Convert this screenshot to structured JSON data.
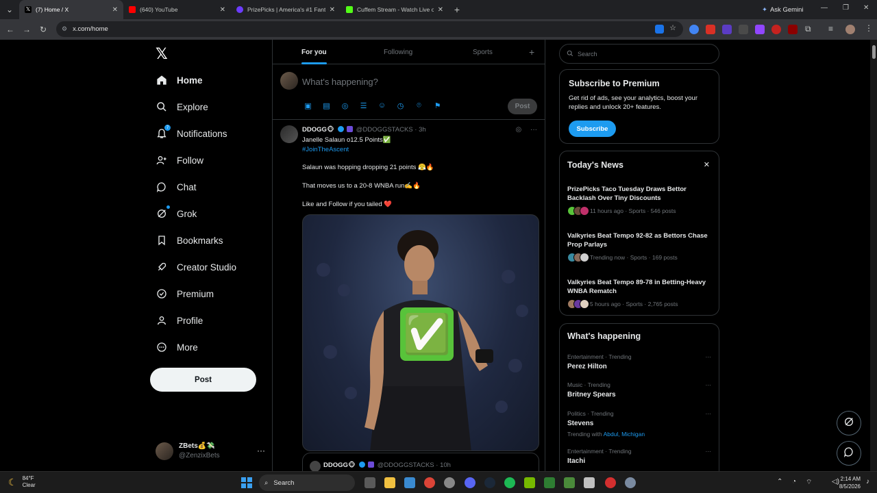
{
  "browser": {
    "tabs": [
      {
        "label": "(7) Home / X",
        "color": "#000000"
      },
      {
        "label": "(640) YouTube",
        "color": "#ff0000"
      },
      {
        "label": "PrizePicks | America's #1 Fanta…",
        "color": "#6c3cff"
      },
      {
        "label": "Cuffem Stream - Watch Live on…",
        "color": "#53fc18"
      }
    ],
    "url": "x.com/home",
    "ask_gemini": "Ask Gemini"
  },
  "nav": {
    "items": [
      {
        "label": "Home",
        "icon": "home-icon"
      },
      {
        "label": "Explore",
        "icon": "search-icon"
      },
      {
        "label": "Notifications",
        "icon": "bell-icon"
      },
      {
        "label": "Follow",
        "icon": "person-add-icon"
      },
      {
        "label": "Chat",
        "icon": "chat-icon"
      },
      {
        "label": "Grok",
        "icon": "grok-icon"
      },
      {
        "label": "Bookmarks",
        "icon": "bookmark-icon"
      },
      {
        "label": "Creator Studio",
        "icon": "rocket-icon"
      },
      {
        "label": "Premium",
        "icon": "verified-icon"
      },
      {
        "label": "Profile",
        "icon": "person-icon"
      },
      {
        "label": "More",
        "icon": "more-circle-icon"
      }
    ],
    "notif_count": "7",
    "post_label": "Post",
    "account": {
      "display_name": "ZBets💰💸",
      "handle": "@ZenzixBets"
    }
  },
  "feed": {
    "tabs": [
      "For you",
      "Following",
      "Sports"
    ],
    "compose_placeholder": "What's happening?",
    "compose_post": "Post",
    "tweet": {
      "display_name": "DDOGG🐵",
      "handle": "@DDOGGSTACKS",
      "time": "3h",
      "lines": [
        "Janelle Salaun o12.5 Points✅",
        "#JoinTheAscent",
        "Salaun was hopping dropping 21 points 😤🔥",
        "That moves us to a 20-8 WNBA run✍️🔥",
        "Like and Follow if you tailed ❤️"
      ],
      "image_badge": "✅",
      "quoted": {
        "display_name": "DDOGG🐵",
        "handle": "@DDOGGSTACKS",
        "time": "10h"
      }
    }
  },
  "right": {
    "search_placeholder": "Search",
    "premium": {
      "title": "Subscribe to Premium",
      "body": "Get rid of ads, see your analytics, boost your replies and unlock 20+ features.",
      "button": "Subscribe"
    },
    "news": {
      "title": "Today's News",
      "items": [
        {
          "title": "PrizePicks Taco Tuesday Draws Bettor Backlash Over Tiny Discounts",
          "meta": "11 hours ago · Sports · 546 posts"
        },
        {
          "title": "Valkyries Beat Tempo 92-82 as Bettors Chase Prop Parlays",
          "meta": "Trending now · Sports · 169 posts"
        },
        {
          "title": "Valkyries Beat Tempo 89-78 in Betting-Heavy WNBA Rematch",
          "meta": "5 hours ago · Sports · 2,765 posts"
        }
      ]
    },
    "happening": {
      "title": "What's happening",
      "items": [
        {
          "category": "Entertainment · Trending",
          "name": "Perez Hilton"
        },
        {
          "category": "Music · Trending",
          "name": "Britney Spears"
        },
        {
          "category": "Politics · Trending",
          "name": "Stevens",
          "trending_with_label": "Trending with",
          "trending_with": "Abdul, Michigan"
        },
        {
          "category": "Entertainment · Trending",
          "name": "Itachi"
        }
      ]
    }
  },
  "taskbar": {
    "weather_temp": "84°F",
    "weather_desc": "Clear",
    "search": "Search",
    "time": "2:14 AM",
    "date": "8/5/2026"
  },
  "colors": {
    "accent": "#1d9bf0",
    "background": "#000000",
    "border": "#2f3336",
    "muted": "#71767b"
  }
}
